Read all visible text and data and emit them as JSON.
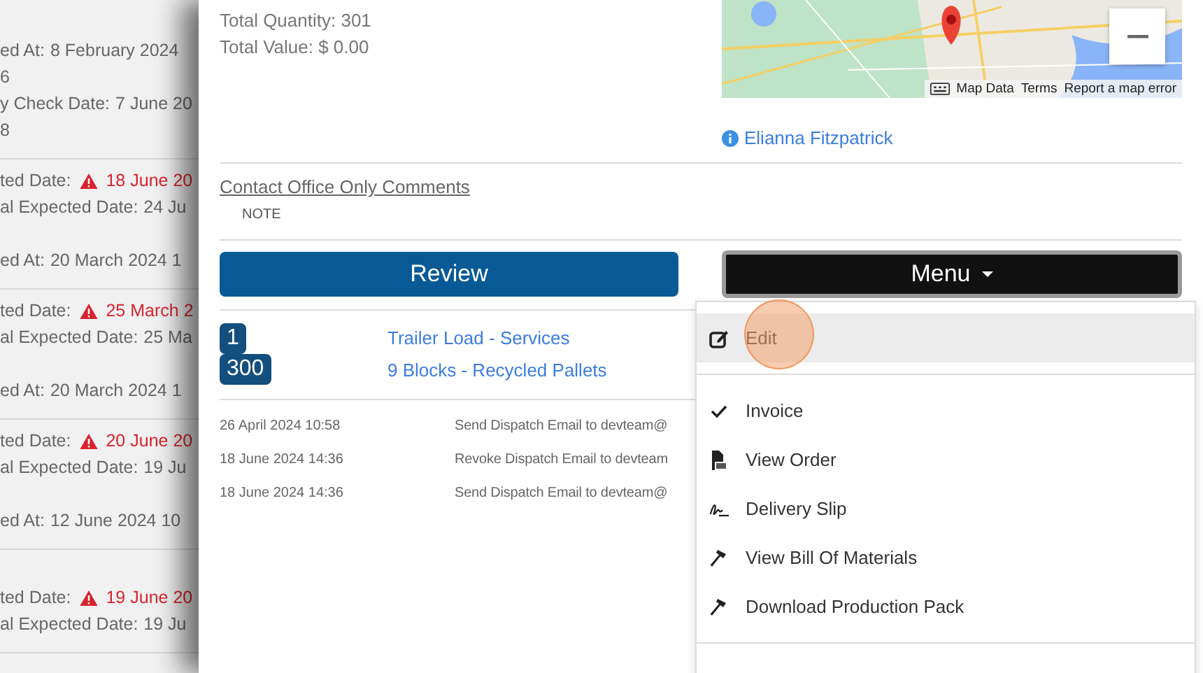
{
  "background_list": [
    {
      "lines": [
        {
          "kind": "field",
          "label": "ed At:",
          "value": "8 February 2024",
          "warning": false
        },
        {
          "kind": "field",
          "value": "6",
          "warning": false
        },
        {
          "kind": "field",
          "label": "y Check Date:",
          "value": "7 June 20",
          "warning": false
        },
        {
          "kind": "field",
          "value": "8",
          "warning": false
        }
      ]
    },
    {
      "lines": [
        {
          "kind": "field",
          "label": "ted Date:",
          "value": "18 June 20",
          "warning": true
        },
        {
          "kind": "field",
          "label": "al Expected Date:",
          "value": "24 Ju",
          "warning": false
        },
        {
          "kind": "gap"
        },
        {
          "kind": "field",
          "label": "ed At:",
          "value": "20 March 2024 1",
          "warning": false
        }
      ]
    },
    {
      "lines": [
        {
          "kind": "field",
          "label": "ted Date:",
          "value": "25 March 2",
          "warning": true
        },
        {
          "kind": "field",
          "label": "al Expected Date:",
          "value": "25 Ma",
          "warning": false
        },
        {
          "kind": "gap"
        },
        {
          "kind": "field",
          "label": "ed At:",
          "value": "20 March 2024 1",
          "warning": false
        }
      ]
    },
    {
      "lines": [
        {
          "kind": "field",
          "label": "ted Date:",
          "value": "20 June 20",
          "warning": true
        },
        {
          "kind": "field",
          "label": "al Expected Date:",
          "value": "19 Ju",
          "warning": false
        },
        {
          "kind": "gap"
        },
        {
          "kind": "field",
          "label": "ed At:",
          "value": "12 June 2024 10",
          "warning": false
        }
      ]
    },
    {
      "lines": [
        {
          "kind": "gap"
        },
        {
          "kind": "field",
          "label": "ted Date:",
          "value": "19 June 20",
          "warning": true
        },
        {
          "kind": "field",
          "label": "al Expected Date:",
          "value": "19 Ju",
          "warning": false
        }
      ]
    }
  ],
  "summary": [
    "Total Quantity: 301",
    "Total Value: $ 0.00"
  ],
  "map": {
    "kind": "picture",
    "attribution": [
      "Map Data",
      "Terms",
      "Report a map error"
    ]
  },
  "contact_link": "Elianna Fitzpatrick",
  "comments": {
    "title": "Contact Office Only Comments",
    "note": "NOTE"
  },
  "buttons": [
    {
      "label": "Review",
      "kind": "primary"
    },
    {
      "label": "Menu",
      "kind": "dropdown"
    }
  ],
  "lines": [
    {
      "quantity": "1",
      "description": "Trailer Load - Services"
    },
    {
      "quantity": "300",
      "description": "9 Blocks - Recycled Pallets"
    }
  ],
  "log": [
    {
      "date": "26 April 2024 10:58",
      "message": "Send Dispatch Email to devteam@"
    },
    {
      "date": "18 June 2024 14:36",
      "message": "Revoke Dispatch Email to devteam"
    },
    {
      "date": "18 June 2024 14:36",
      "message": "Send Dispatch Email to devteam@"
    }
  ],
  "menu": {
    "items": [
      {
        "kind": "edit",
        "label": "Edit",
        "selected": true
      },
      {
        "kind": "divider"
      },
      {
        "kind": "check",
        "label": "Invoice",
        "selected": false
      },
      {
        "kind": "pdf",
        "label": "View Order",
        "selected": false
      },
      {
        "kind": "signature",
        "label": "Delivery Slip",
        "selected": false
      },
      {
        "kind": "hammer",
        "label": "View Bill Of Materials",
        "selected": false
      },
      {
        "kind": "hammer",
        "label": "Download Production Pack",
        "selected": false
      },
      {
        "kind": "divider"
      }
    ]
  }
}
